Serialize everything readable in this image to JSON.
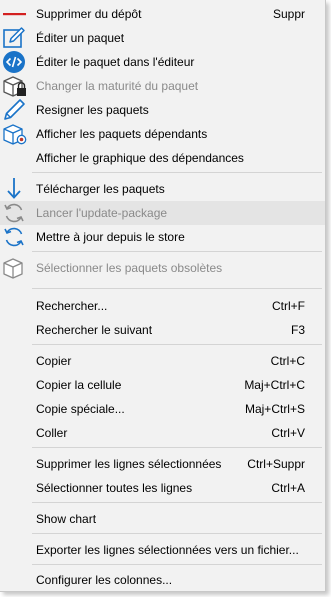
{
  "menu": {
    "items": [
      {
        "label": "Supprimer du dépôt",
        "shortcut": "Suppr",
        "icon": "remove-icon",
        "enabled": true
      },
      {
        "label": "Éditer un paquet",
        "shortcut": "",
        "icon": "edit-icon",
        "enabled": true
      },
      {
        "label": "Éditer le paquet dans l'éditeur",
        "shortcut": "",
        "icon": "code-editor-icon",
        "enabled": true
      },
      {
        "label": "Changer la maturité du paquet",
        "shortcut": "",
        "icon": "package-lock-icon",
        "enabled": false
      },
      {
        "label": "Resigner les paquets",
        "shortcut": "",
        "icon": "pen-icon",
        "enabled": true
      },
      {
        "label": "Afficher les paquets dépendants",
        "shortcut": "",
        "icon": "package-dependents-icon",
        "enabled": true
      },
      {
        "label": "Afficher le graphique des dépendances",
        "shortcut": "",
        "icon": "",
        "enabled": true
      },
      {
        "label": "Télécharger les paquets",
        "shortcut": "",
        "icon": "download-arrow-icon",
        "enabled": true
      },
      {
        "label": "Lancer l'update-package",
        "shortcut": "",
        "icon": "refresh-icon",
        "enabled": false
      },
      {
        "label": "Mettre à jour depuis le store",
        "shortcut": "",
        "icon": "refresh-icon",
        "enabled": true
      },
      {
        "label": "Sélectionner les paquets obsolètes",
        "shortcut": "",
        "icon": "package-icon",
        "enabled": false
      },
      {
        "label": "Rechercher...",
        "shortcut": "Ctrl+F",
        "icon": "",
        "enabled": true
      },
      {
        "label": "Rechercher le suivant",
        "shortcut": "F3",
        "icon": "",
        "enabled": true
      },
      {
        "label": "Copier",
        "shortcut": "Ctrl+C",
        "icon": "",
        "enabled": true
      },
      {
        "label": "Copier la cellule",
        "shortcut": "Maj+Ctrl+C",
        "icon": "",
        "enabled": true
      },
      {
        "label": "Copie spéciale...",
        "shortcut": "Maj+Ctrl+S",
        "icon": "",
        "enabled": true
      },
      {
        "label": "Coller",
        "shortcut": "Ctrl+V",
        "icon": "",
        "enabled": true
      },
      {
        "label": "Supprimer les lignes sélectionnées",
        "shortcut": "Ctrl+Suppr",
        "icon": "",
        "enabled": true
      },
      {
        "label": "Sélectionner toutes les lignes",
        "shortcut": "Ctrl+A",
        "icon": "",
        "enabled": true
      },
      {
        "label": "Show chart",
        "shortcut": "",
        "icon": "",
        "enabled": true
      },
      {
        "label": "Exporter les lignes sélectionnées vers un fichier...",
        "shortcut": "",
        "icon": "",
        "enabled": true
      },
      {
        "label": "Configurer les colonnes...",
        "shortcut": "",
        "icon": "",
        "enabled": true
      }
    ]
  },
  "colors": {
    "menu_background": "#f2f2f2",
    "highlight": "#e4e4e4",
    "remove_red": "#d32020",
    "accent_blue": "#1a73c8",
    "disabled_text": "#8a8a8a"
  }
}
